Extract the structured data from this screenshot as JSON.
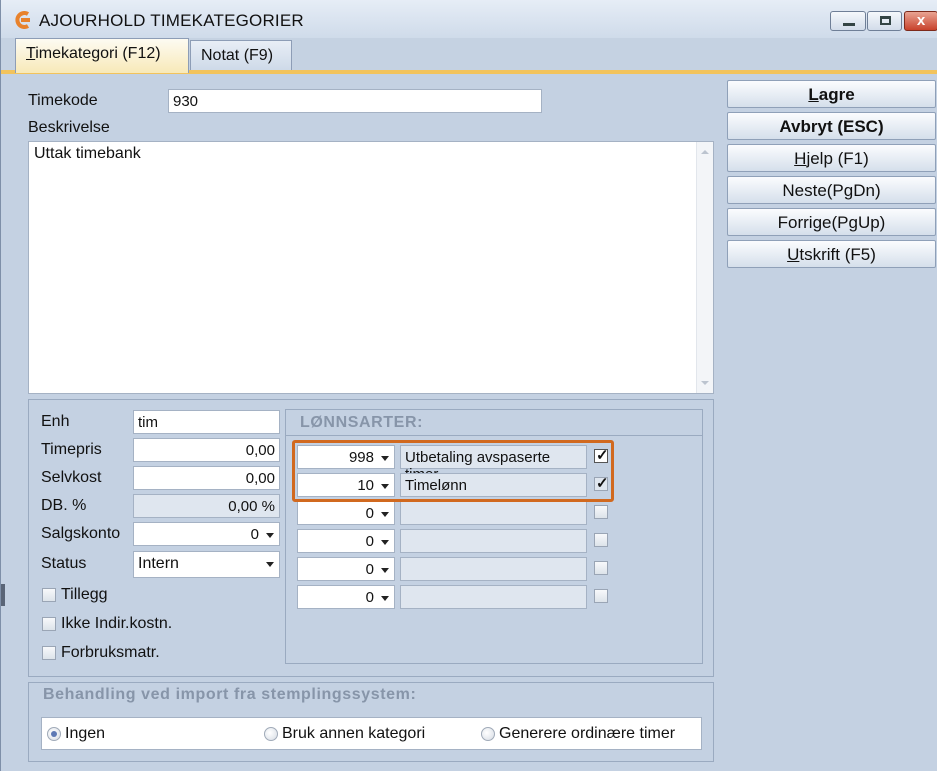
{
  "window": {
    "title": "AJOURHOLD TIMEKATEGORIER",
    "close_glyph": "x"
  },
  "tabs": [
    {
      "label_prefix": "T",
      "label_rest": "imekategori (F12)",
      "active": true
    },
    {
      "label": "Notat (F9)",
      "active": false
    }
  ],
  "form": {
    "timekode_label": "Timekode",
    "timekode_value": "930",
    "beskrivelse_label": "Beskrivelse",
    "beskrivelse_value": "Uttak timebank",
    "enh_label": "Enh",
    "enh_value": "tim",
    "timepris_label": "Timepris",
    "timepris_value": "0,00",
    "selvkost_label": "Selvkost",
    "selvkost_value": "0,00",
    "db_label": "DB. %",
    "db_value": "0,00 %",
    "salgskonto_label": "Salgskonto",
    "salgskonto_value": "0",
    "status_label": "Status",
    "status_value": "Intern",
    "tillegg_label": "Tillegg",
    "ikke_indir_label": "Ikke Indir.kostn.",
    "forbruksmatr_label": "Forbruksmatr."
  },
  "lonnsarter": {
    "title": "LØNNSARTER:",
    "rows": [
      {
        "code": "998",
        "desc": "Utbetaling avspaserte timer",
        "checked": true
      },
      {
        "code": "10",
        "desc": "Timelønn",
        "checked": true
      },
      {
        "code": "0",
        "desc": "",
        "checked": false
      },
      {
        "code": "0",
        "desc": "",
        "checked": false
      },
      {
        "code": "0",
        "desc": "",
        "checked": false
      },
      {
        "code": "0",
        "desc": "",
        "checked": false
      }
    ]
  },
  "buttons": {
    "lagre_u": "L",
    "lagre_rest": "agre",
    "avbryt": "Avbryt (ESC)",
    "hjelp_u": "H",
    "hjelp_rest": "jelp (F1)",
    "neste": "Neste(PgDn)",
    "forrige": "Forrige(PgUp)",
    "utskrift_u": "U",
    "utskrift_rest": "tskrift (F5)"
  },
  "import": {
    "title": "Behandling ved import fra stemplingssystem:",
    "options": [
      "Ingen",
      "Bruk annen kategori",
      "Generere ordinære timer"
    ],
    "selected": "Ingen"
  },
  "colors": {
    "highlight": "#d1691f",
    "tab_accent": "#f2c35c"
  }
}
